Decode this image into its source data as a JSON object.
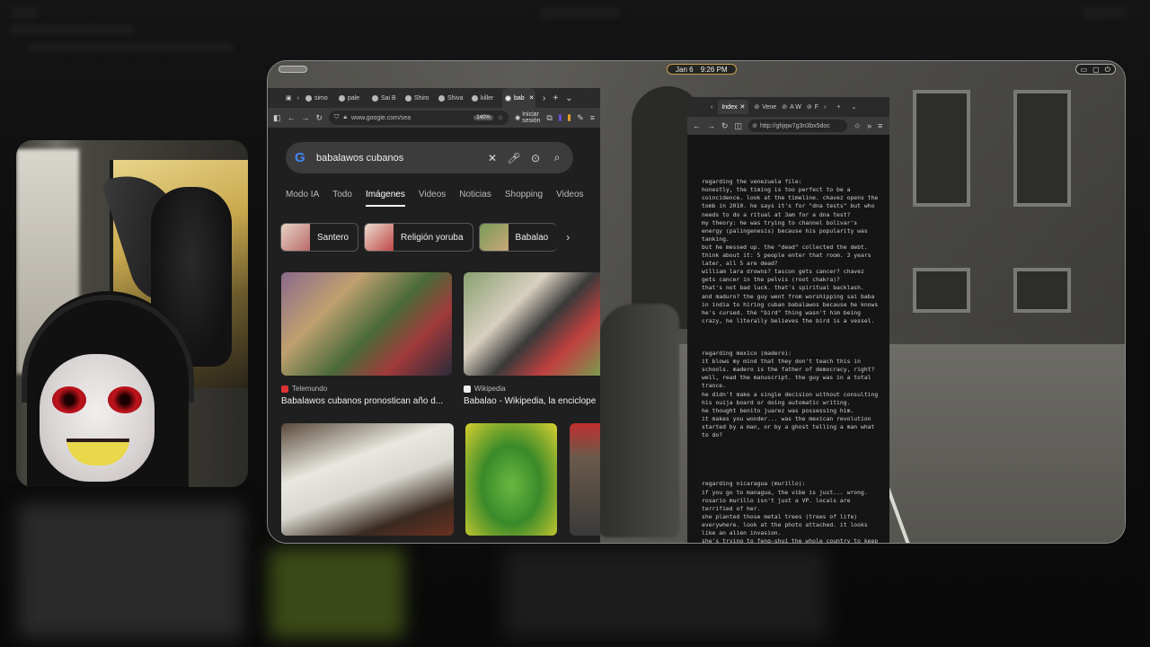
{
  "topbar": {
    "date": "Jan 6",
    "time": "9:26 PM"
  },
  "chrome": {
    "tabs": [
      {
        "label": "simo"
      },
      {
        "label": "pale"
      },
      {
        "label": "Sai B"
      },
      {
        "label": "Shiro"
      },
      {
        "label": "Shiva"
      },
      {
        "label": "killer"
      },
      {
        "label": "bab",
        "active": true
      }
    ],
    "url": "www.google.com/sea",
    "zoom": "140%",
    "session_label": "Iniciar sesión",
    "search_query": "babalawos cubanos",
    "nav_tabs": [
      {
        "label": "Modo IA"
      },
      {
        "label": "Todo"
      },
      {
        "label": "Imágenes",
        "active": true
      },
      {
        "label": "Videos"
      },
      {
        "label": "Noticias"
      },
      {
        "label": "Shopping"
      },
      {
        "label": "Videos"
      }
    ],
    "chips": [
      {
        "label": "Santero"
      },
      {
        "label": "Religión yoruba"
      },
      {
        "label": "Babalao"
      }
    ],
    "results": [
      {
        "source": "Telemundo",
        "caption": "Babalawos cubanos pronostican año d..."
      },
      {
        "source": "Wikipedia",
        "caption": "Babalao - Wikipedia, la enciclope"
      },
      {
        "source": "",
        "caption": ""
      },
      {
        "source": "",
        "caption": ""
      }
    ]
  },
  "notes_browser": {
    "tabs": [
      {
        "label": "Index",
        "active": true
      },
      {
        "label": "Vene"
      },
      {
        "label": "A W"
      },
      {
        "label": "F"
      }
    ],
    "url": "http://ghjqw7g3n3bx5doc"
  },
  "notes": [
    "regarding the venezuela file:\nhonestly, the timing is too perfect to be a coincidence. look at the timeline. chavez opens the tomb in 2010. he says it's for \"dna tests\" but who needs to do a ritual at 3am for a dna test?\nmy theory: he was trying to channel bolivar's energy (palingenesis) because his popularity was tanking.\nbut he messed up. the \"dead\" collected the debt. think about it: 5 people enter that room. 3 years later, all 5 are dead?\nwilliam lara drowns? tascon gets cancer? chavez gets cancer in the pelvis (root chakra)?\nthat's not bad luck. that's spiritual backlash.\nand maduro? the guy went from worshipping sai baba in india to hiring cuban babalawos because he knows he's cursed. the \"bird\" thing wasn't him being crazy, he literally believes the bird is a vessel.",
    "regarding mexico (madero):\nit blows my mind that they don't teach this in schools. madero is the father of democracy, right?\nwell, read the manuscript. the guy was in a total trance.\nhe didn't make a single decision without consulting his ouija board or doing automatic writing.\nhe thought benito juarez was possessing him.\nit makes you wonder... was the mexican revolution started by a man, or by a ghost telling a man what to do?",
    "\n\nregarding nicaragua (murillo):\nif you go to managua, the vibe is just... wrong. rosario murillo isn't just a VP. locals are terrified of her.\nshe planted those metal trees (trees of life) everywhere. look at the photo attached. it looks like an alien invasion.\nshe's trying to feng-shui the whole country to keep them in power."
  ]
}
